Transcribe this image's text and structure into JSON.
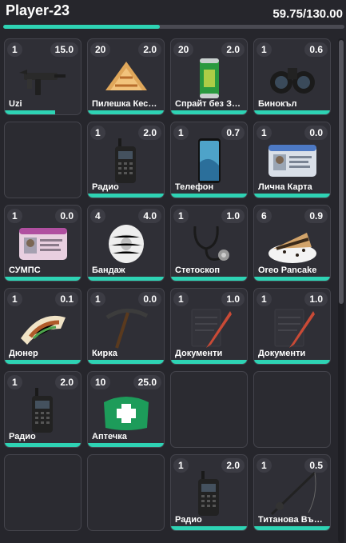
{
  "header": {
    "player_name": "Player-23",
    "weight_text": "59.75/130.00",
    "weight_fraction": 0.46
  },
  "accent_color": "#2ed3b4",
  "slots": [
    {
      "qty": "1",
      "weight": "15.0",
      "label": "Uzi",
      "icon": "uzi-icon",
      "durability": 0.66
    },
    {
      "qty": "20",
      "weight": "2.0",
      "label": "Пилешка Кесадиля",
      "icon": "quesadilla-icon",
      "durability": 1
    },
    {
      "qty": "20",
      "weight": "2.0",
      "label": "Спрайт без Захар",
      "icon": "soda-can-icon",
      "durability": 1
    },
    {
      "qty": "1",
      "weight": "0.6",
      "label": "Бинокъл",
      "icon": "binoculars-icon",
      "durability": 1
    },
    {
      "empty": true
    },
    {
      "qty": "1",
      "weight": "2.0",
      "label": "Радио",
      "icon": "radio-icon",
      "durability": 1
    },
    {
      "qty": "1",
      "weight": "0.7",
      "label": "Телефон",
      "icon": "phone-icon",
      "durability": 1
    },
    {
      "qty": "1",
      "weight": "0.0",
      "label": "Лична Карта",
      "icon": "id-card-icon",
      "durability": 1
    },
    {
      "qty": "1",
      "weight": "0.0",
      "label": "СУМПС",
      "icon": "license-card-icon",
      "durability": 1
    },
    {
      "qty": "4",
      "weight": "4.0",
      "label": "Бандаж",
      "icon": "bandage-icon",
      "durability": 1
    },
    {
      "qty": "1",
      "weight": "1.0",
      "label": "Стетоскоп",
      "icon": "stethoscope-icon",
      "durability": 1
    },
    {
      "qty": "6",
      "weight": "0.9",
      "label": "Oreo Pancake",
      "icon": "pancake-icon",
      "durability": 1
    },
    {
      "qty": "1",
      "weight": "0.1",
      "label": "Дюнер",
      "icon": "doner-icon",
      "durability": 1
    },
    {
      "qty": "1",
      "weight": "0.0",
      "label": "Кирка",
      "icon": "pickaxe-icon",
      "durability": 1
    },
    {
      "qty": "1",
      "weight": "1.0",
      "label": "Документи",
      "icon": "documents-icon",
      "durability": 1
    },
    {
      "qty": "1",
      "weight": "1.0",
      "label": "Документи",
      "icon": "documents-icon",
      "durability": 1
    },
    {
      "qty": "1",
      "weight": "2.0",
      "label": "Радио",
      "icon": "radio-icon",
      "durability": 1
    },
    {
      "qty": "10",
      "weight": "25.0",
      "label": "Аптечка",
      "icon": "first-aid-kit-icon",
      "durability": 1
    },
    {
      "empty": true
    },
    {
      "empty": true
    },
    {
      "empty": true
    },
    {
      "empty": true
    },
    {
      "qty": "1",
      "weight": "2.0",
      "label": "Радио",
      "icon": "radio-icon",
      "durability": 1
    },
    {
      "qty": "1",
      "weight": "0.5",
      "label": "Титанова Въдица",
      "icon": "fishing-rod-icon",
      "durability": 1
    }
  ]
}
